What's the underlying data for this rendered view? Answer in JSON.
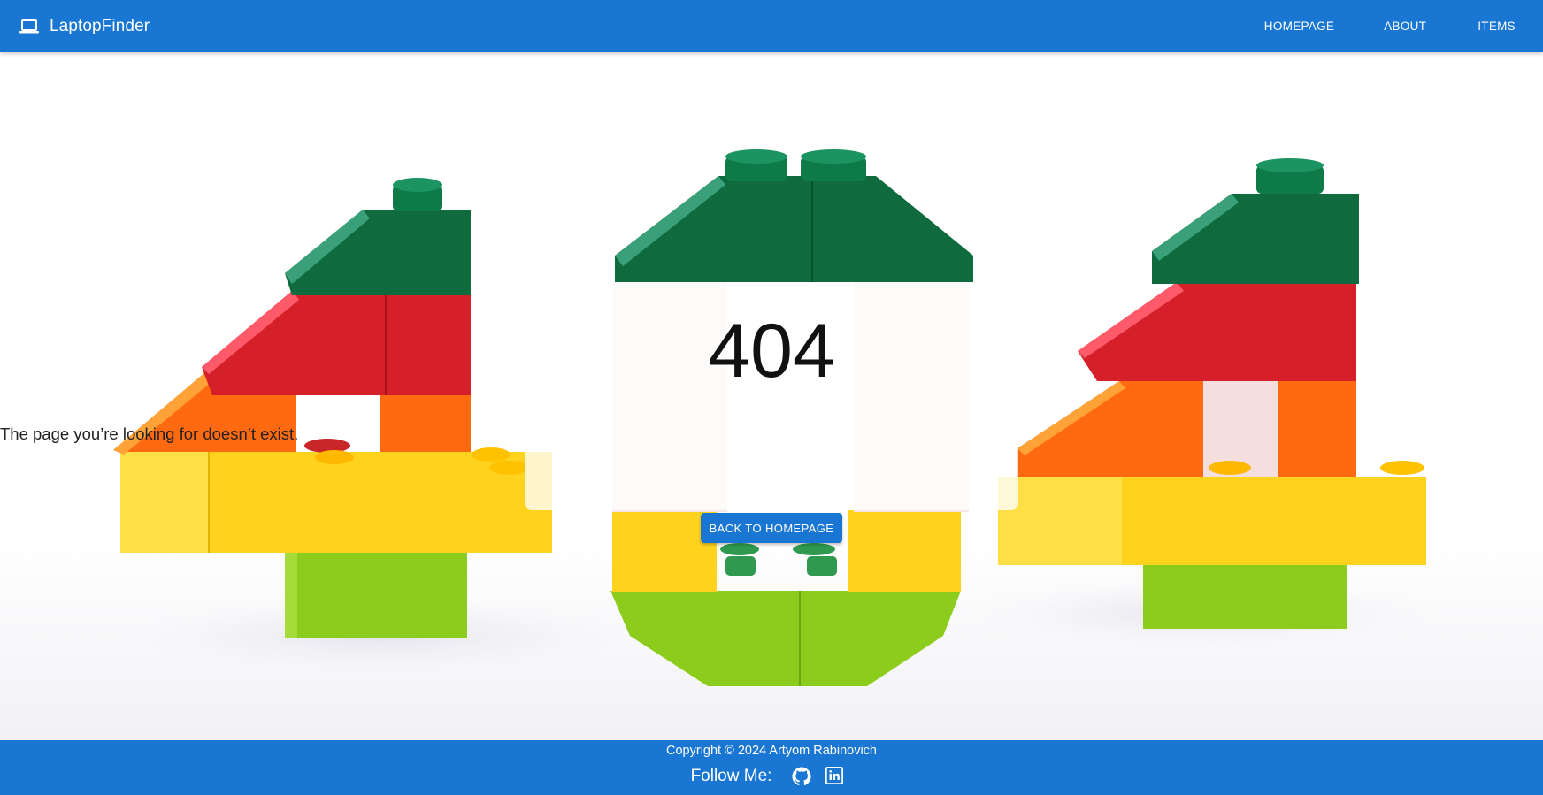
{
  "header": {
    "brand": "LaptopFinder",
    "brand_icon": "laptop-icon",
    "nav": [
      {
        "label": "HOMEPAGE"
      },
      {
        "label": "ABOUT"
      },
      {
        "label": "ITEMS"
      }
    ]
  },
  "error": {
    "code": "404",
    "message": "The page you’re looking for doesn’t exist.",
    "button_label": "BACK TO HOMEPAGE"
  },
  "footer": {
    "copyright": "Copyright © 2024 Artyom Rabinovich",
    "follow_label": "Follow Me:",
    "social": [
      {
        "name": "github-icon"
      },
      {
        "name": "linkedin-icon"
      }
    ]
  },
  "colors": {
    "primary": "#1976d2",
    "brick_dark_green": "#0f6b3e",
    "brick_red": "#d5202a",
    "brick_orange": "#ff6a10",
    "brick_yellow": "#ffd21e",
    "brick_lime": "#8ccc1c"
  }
}
